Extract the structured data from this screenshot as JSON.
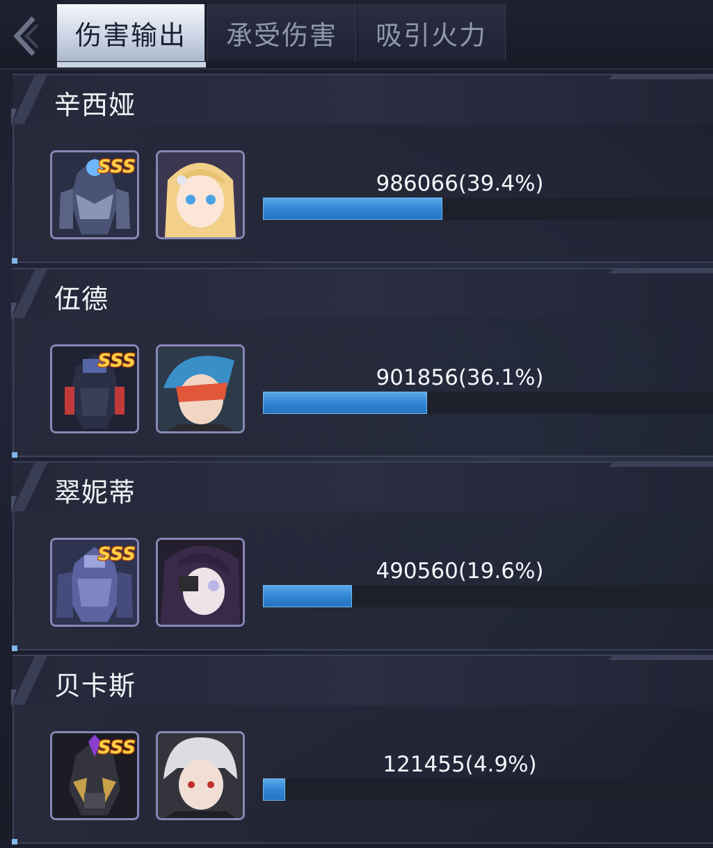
{
  "tabs": [
    {
      "label": "伤害输出",
      "active": true
    },
    {
      "label": "承受伤害",
      "active": false
    },
    {
      "label": "吸引火力",
      "active": false
    }
  ],
  "rows": [
    {
      "name": "辛西娅",
      "rank": "SSS",
      "value_text": "986066(39.4%)",
      "percent": 39.4
    },
    {
      "name": "伍德",
      "rank": "SSS",
      "value_text": "901856(36.1%)",
      "percent": 36.1
    },
    {
      "name": "翠妮蒂",
      "rank": "SSS",
      "value_text": "490560(19.6%)",
      "percent": 19.6
    },
    {
      "name": "贝卡斯",
      "rank": "SSS",
      "value_text": "121455(4.9%)",
      "percent": 4.9
    }
  ],
  "colors": {
    "bar": "#2f84d3",
    "rank_badge": "#ffd24a",
    "frame": "#8a86b6"
  },
  "icons": {
    "back": "chevron-left-icon"
  }
}
